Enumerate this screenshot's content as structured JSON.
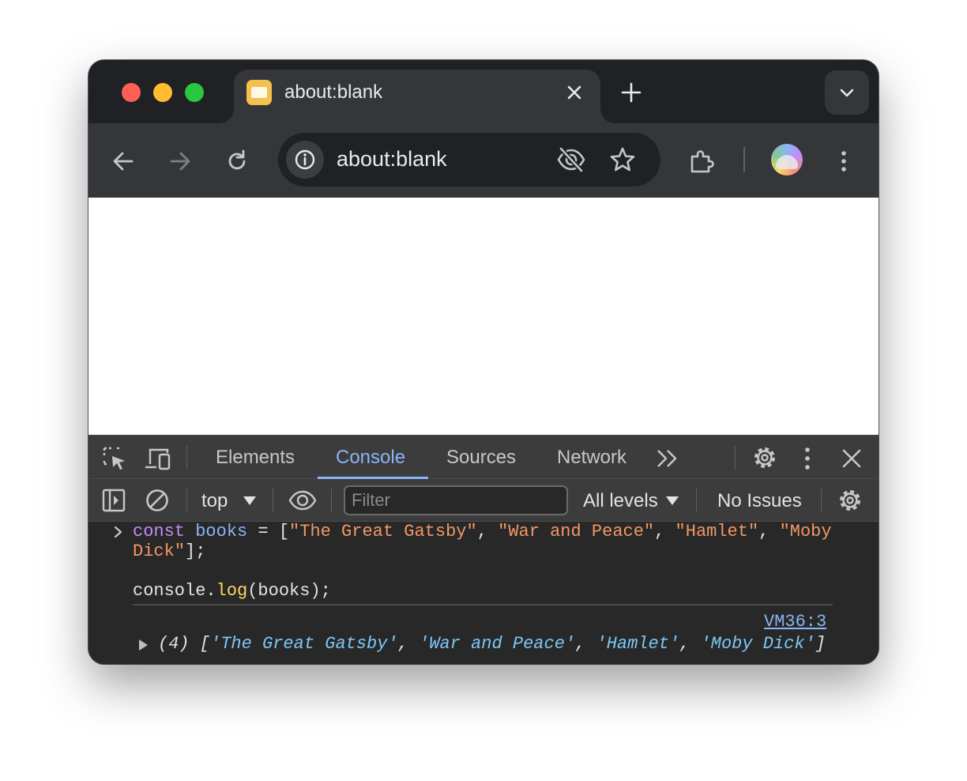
{
  "browser": {
    "tab": {
      "title": "about:blank"
    },
    "omnibox": {
      "url": "about:blank"
    }
  },
  "devtools": {
    "tabs": [
      "Elements",
      "Console",
      "Sources",
      "Network"
    ],
    "active_tab": "Console",
    "console_toolbar": {
      "context": "top",
      "filter_placeholder": "Filter",
      "filter_value": "",
      "levels": "All levels",
      "issues": "No Issues"
    },
    "console": {
      "input": {
        "line1": {
          "kw": "const",
          "var": "books",
          "eq": " = [",
          "s1": "\"The Great Gatsby\"",
          "c1": ", ",
          "s2": "\"War and Peace\"",
          "c2": ", ",
          "s3": "\"Hamlet\"",
          "c3": ", ",
          "s4a": "\"Moby"
        },
        "line2": {
          "s4b": "Dick\"",
          "end": "];"
        },
        "line4": {
          "obj": "console.",
          "fn": "log",
          "args": "(books);"
        }
      },
      "output": {
        "source": "VM36:3",
        "count": "(4) [",
        "items": [
          "'The Great Gatsby'",
          "'War and Peace'",
          "'Hamlet'",
          "'Moby Dick'"
        ],
        "sep": ", ",
        "close": "]"
      }
    }
  },
  "colors": {
    "accent": "#8ab4f8",
    "keyword": "#c58af9",
    "string": "#f29766",
    "function": "#fdd663"
  }
}
